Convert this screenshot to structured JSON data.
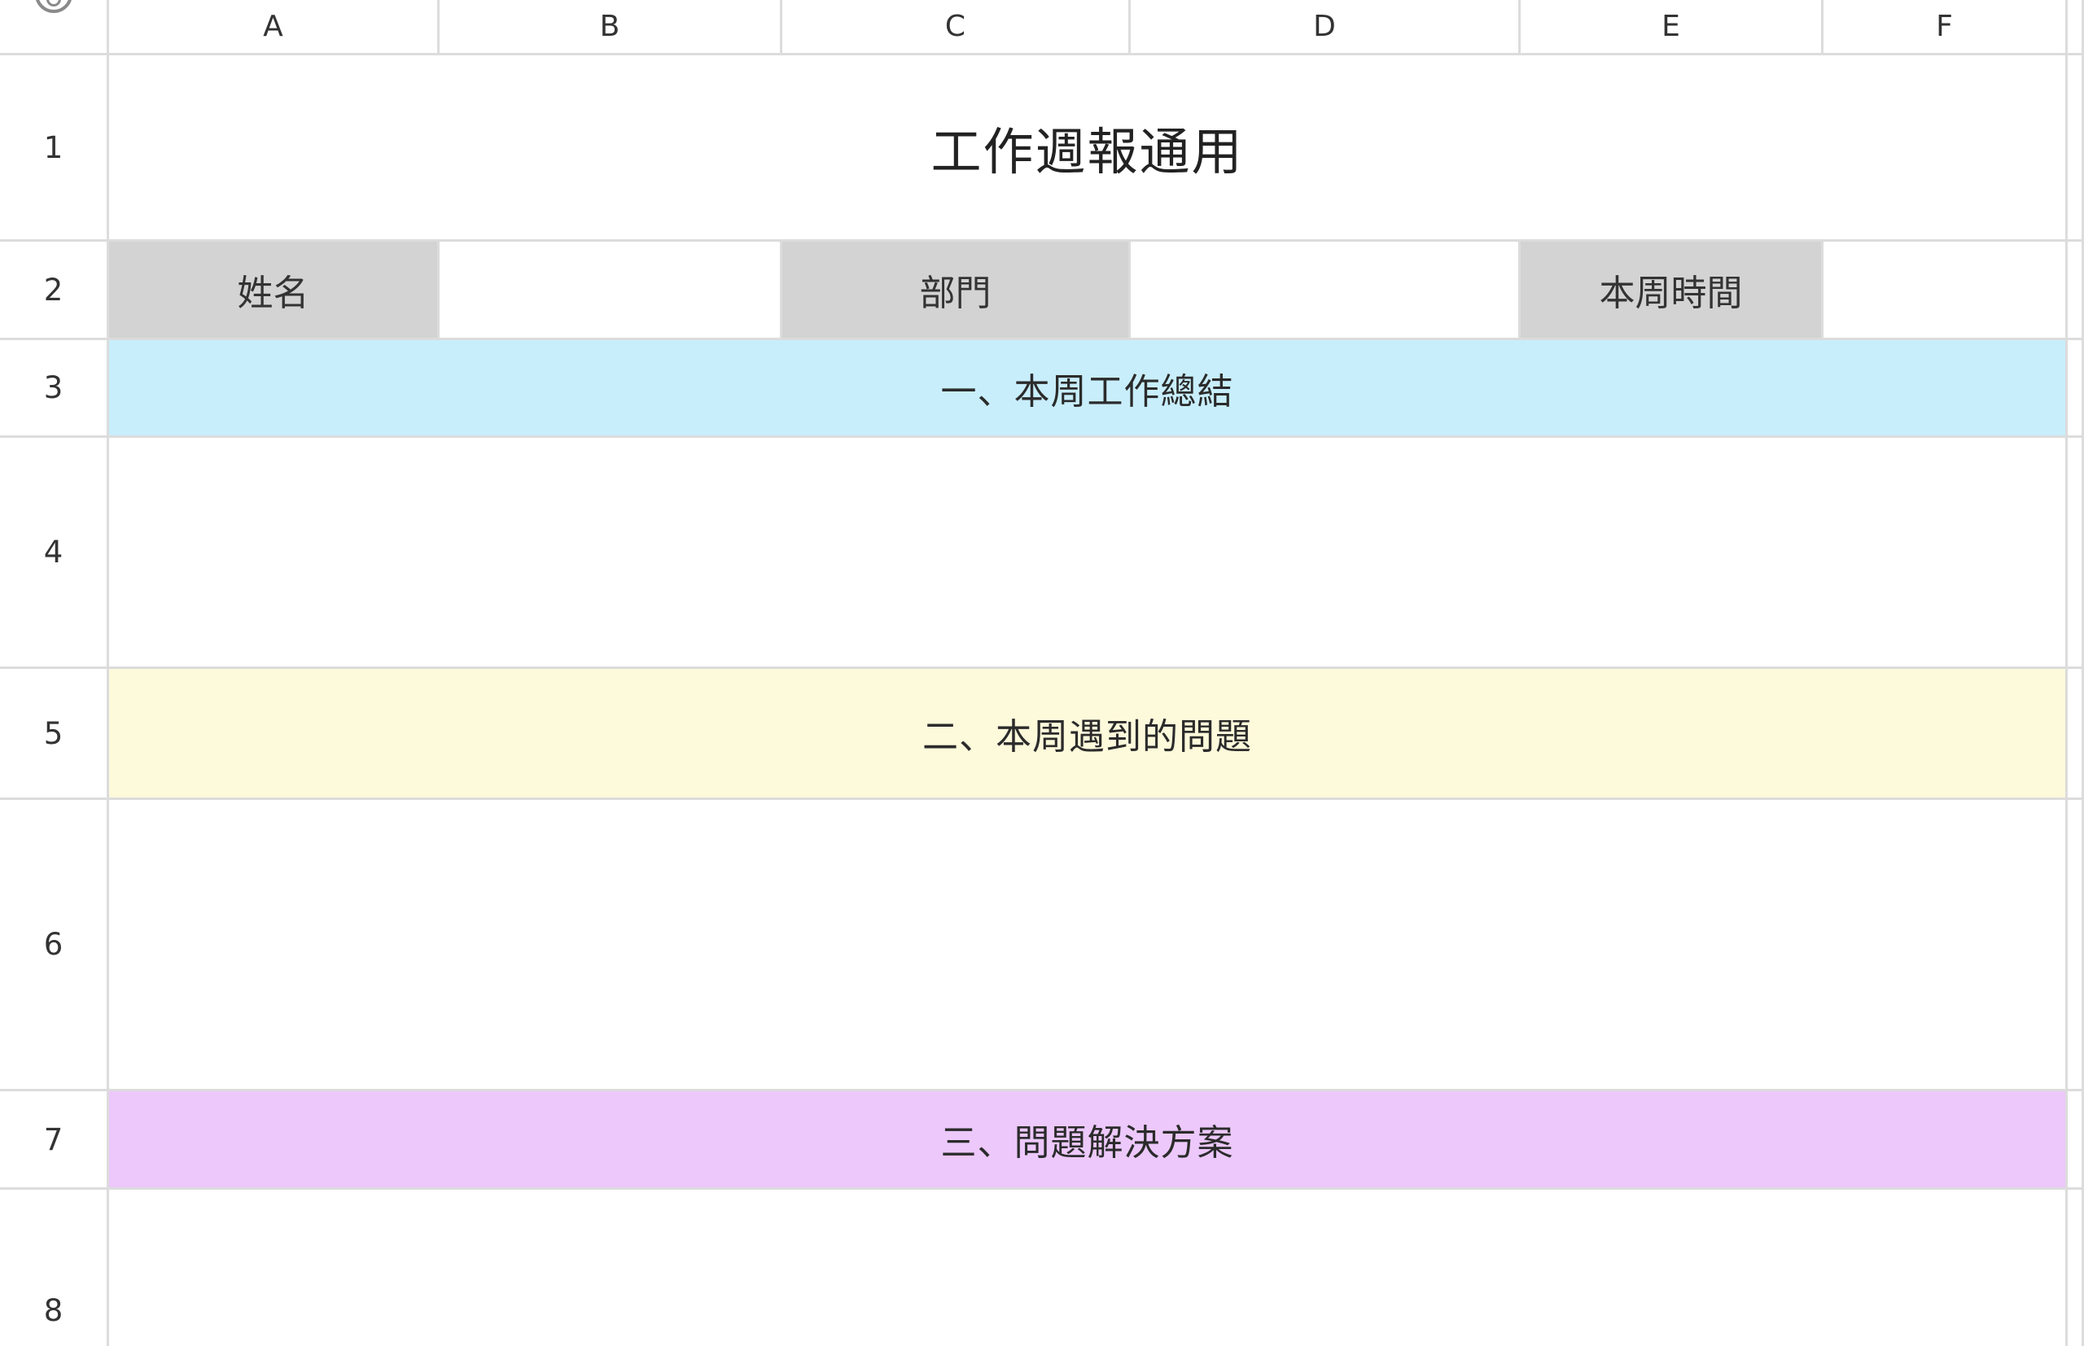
{
  "columns": [
    "A",
    "B",
    "C",
    "D",
    "E",
    "F"
  ],
  "rows": [
    "1",
    "2",
    "3",
    "4",
    "5",
    "6",
    "7",
    "8"
  ],
  "title": "工作週報通用",
  "header_row": {
    "name_label": "姓名",
    "name_value": "",
    "department_label": "部門",
    "department_value": "",
    "week_label": "本周時間",
    "week_value": ""
  },
  "sections": {
    "summary": "一、本周工作總結",
    "problems": "二、本周遇到的問題",
    "solutions": "三、問題解決方案"
  },
  "colors": {
    "summary_bg": "#c8eefc",
    "problems_bg": "#fdf9db",
    "solutions_bg": "#ecc8fb",
    "label_bg": "#d3d3d3",
    "gridline": "#dcdcdc"
  }
}
